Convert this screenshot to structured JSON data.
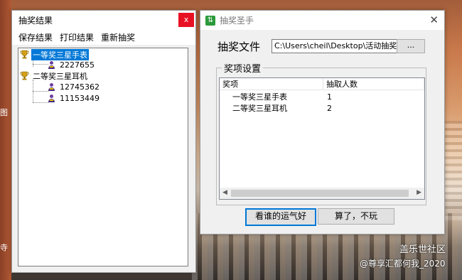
{
  "desktop": {
    "left_chars": [
      "图",
      "寺"
    ],
    "watermark1": "盖乐世社区",
    "watermark2": "@尊享汇都何我_2020"
  },
  "results_window": {
    "title": "抽奖结果",
    "close": "x",
    "menu": [
      "保存结果",
      "打印结果",
      "重新抽奖"
    ],
    "tree": [
      {
        "prize": "一等奖三星手表",
        "winners": [
          "2227655"
        ]
      },
      {
        "prize": "二等奖三星耳机",
        "winners": [
          "12745362",
          "11153449"
        ]
      }
    ]
  },
  "lottery_window": {
    "title": "抽奖圣手",
    "close": "✕",
    "file_label": "抽奖文件",
    "file_path": "C:\\Users\\cheil\\Desktop\\活动抽奖\\",
    "browse_label": "...",
    "group_title": "奖项设置",
    "columns": [
      "奖项",
      "抽取人数"
    ],
    "rows": [
      {
        "prize": "一等奖三星手表",
        "count": "1"
      },
      {
        "prize": "二等奖三星耳机",
        "count": "2"
      }
    ],
    "buttons": {
      "draw": "看谁的运气好",
      "quit": "算了，不玩"
    }
  },
  "colors": {
    "selection": "#0078d7",
    "close_red": "#e81123",
    "app_icon": "#2c9a3b"
  }
}
